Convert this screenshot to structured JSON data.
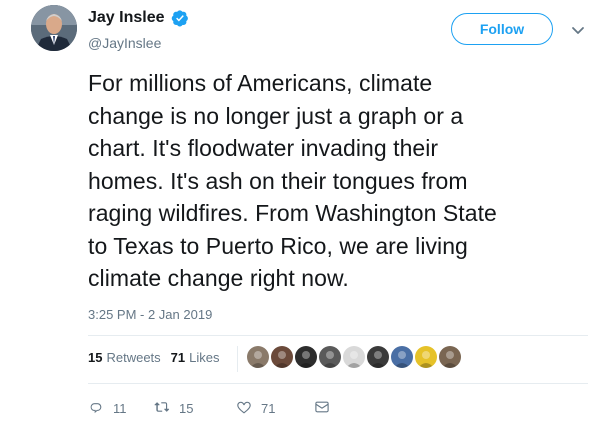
{
  "author": {
    "name": "Jay Inslee",
    "handle": "@JayInslee",
    "verified": true
  },
  "follow_button": {
    "label": "Follow"
  },
  "tweet": {
    "text": "For millions of Americans, climate\nchange is no longer just a graph or a\nchart. It's floodwater invading their\nhomes. It's ash on their tongues from\nraging wildfires. From Washington State\nto Texas to Puerto Rico, we are living\nclimate change right now.",
    "timestamp": "3:25 PM - 2 Jan 2019"
  },
  "stats": {
    "retweets_count": "15",
    "retweets_label": "Retweets",
    "likes_count": "71",
    "likes_label": "Likes"
  },
  "likers": [
    {
      "icon": "liker-avatar-1",
      "color": "#8a7a6a"
    },
    {
      "icon": "liker-avatar-2",
      "color": "#6b4a3a"
    },
    {
      "icon": "liker-avatar-3",
      "color": "#2d2d2d"
    },
    {
      "icon": "liker-avatar-4",
      "color": "#5a5a5a"
    },
    {
      "icon": "liker-avatar-5",
      "color": "#d9d9d9"
    },
    {
      "icon": "liker-avatar-6",
      "color": "#3a3a3a"
    },
    {
      "icon": "liker-avatar-7",
      "color": "#4a6fa5"
    },
    {
      "icon": "liker-avatar-8",
      "color": "#e6c229"
    },
    {
      "icon": "liker-avatar-9",
      "color": "#7a6652"
    }
  ],
  "actions": {
    "reply_count": "11",
    "retweet_count": "15",
    "like_count": "71"
  },
  "colors": {
    "brand_blue": "#1da1f2",
    "text_primary": "#14171a",
    "text_secondary": "#657786",
    "divider": "#e6ecf0"
  }
}
